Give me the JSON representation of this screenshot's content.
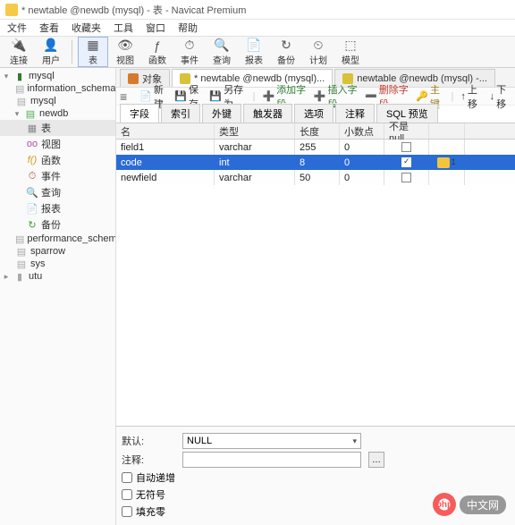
{
  "window": {
    "title": "* newtable @newdb (mysql) - 表 - Navicat Premium"
  },
  "menu": [
    "文件",
    "查看",
    "收藏夹",
    "工具",
    "窗口",
    "帮助"
  ],
  "toolbar": [
    {
      "label": "连接",
      "icon": "🔌"
    },
    {
      "label": "用户",
      "icon": "👤"
    },
    {
      "label": "表",
      "icon": "▦",
      "active": true
    },
    {
      "label": "视图",
      "icon": "👁"
    },
    {
      "label": "函数",
      "icon": "ƒ"
    },
    {
      "label": "事件",
      "icon": "⏱"
    },
    {
      "label": "查询",
      "icon": "🔍"
    },
    {
      "label": "报表",
      "icon": "📄"
    },
    {
      "label": "备份",
      "icon": "↻"
    },
    {
      "label": "计划",
      "icon": "⏲"
    },
    {
      "label": "模型",
      "icon": "⬚"
    }
  ],
  "tree": {
    "root": "mysql",
    "items": [
      {
        "label": "information_schema",
        "cls": "db-gray",
        "indent": "indent1"
      },
      {
        "label": "mysql",
        "cls": "db-gray",
        "indent": "indent1"
      },
      {
        "label": "newdb",
        "cls": "db-ico",
        "indent": "indent1",
        "exp": "▾"
      },
      {
        "label": "表",
        "cls": "tbl-ico",
        "indent": "indent2",
        "sel": true
      },
      {
        "label": "视图",
        "cls": "view-ico",
        "indent": "indent2",
        "pre": "oo"
      },
      {
        "label": "函数",
        "cls": "fn-ico",
        "indent": "indent2",
        "pre": "f()"
      },
      {
        "label": "事件",
        "cls": "ev-ico",
        "indent": "indent2"
      },
      {
        "label": "查询",
        "cls": "qry-ico",
        "indent": "indent2"
      },
      {
        "label": "报表",
        "cls": "rpt-ico",
        "indent": "indent2"
      },
      {
        "label": "备份",
        "cls": "bk-ico",
        "indent": "indent2"
      },
      {
        "label": "performance_schema",
        "cls": "db-gray",
        "indent": "indent1"
      },
      {
        "label": "sparrow",
        "cls": "db-gray",
        "indent": "indent1"
      },
      {
        "label": "sys",
        "cls": "db-gray",
        "indent": "indent1"
      }
    ],
    "root2": "utu"
  },
  "tabs": [
    {
      "label": "对象"
    },
    {
      "label": "* newtable @newdb (mysql)...",
      "active": true
    },
    {
      "label": "newtable @newdb (mysql) -..."
    }
  ],
  "actions": {
    "new": "新建",
    "save": "保存",
    "saveas": "另存为",
    "addfield": "添加字段",
    "insertfield": "插入字段",
    "delfield": "删除字段",
    "pkey": "主键",
    "up": "上移",
    "down": "下移"
  },
  "subtabs": [
    "字段",
    "索引",
    "外键",
    "触发器",
    "选项",
    "注释",
    "SQL 预览"
  ],
  "cols": {
    "name": "名",
    "type": "类型",
    "len": "长度",
    "dec": "小数点",
    "null": "不是 null"
  },
  "rows": [
    {
      "name": "field1",
      "type": "varchar",
      "len": "255",
      "dec": "0",
      "null": false,
      "key": false
    },
    {
      "name": "code",
      "type": "int",
      "len": "8",
      "dec": "0",
      "null": true,
      "key": true,
      "sel": true
    },
    {
      "name": "newfield",
      "type": "varchar",
      "len": "50",
      "dec": "0",
      "null": false,
      "key": false
    }
  ],
  "bottom": {
    "default_label": "默认:",
    "default_value": "NULL",
    "comment_label": "注释:",
    "auto_inc": "自动递增",
    "unsigned": "无符号",
    "zerofill": "填充零"
  },
  "watermark": {
    "logo": "php",
    "text": "中文网"
  }
}
